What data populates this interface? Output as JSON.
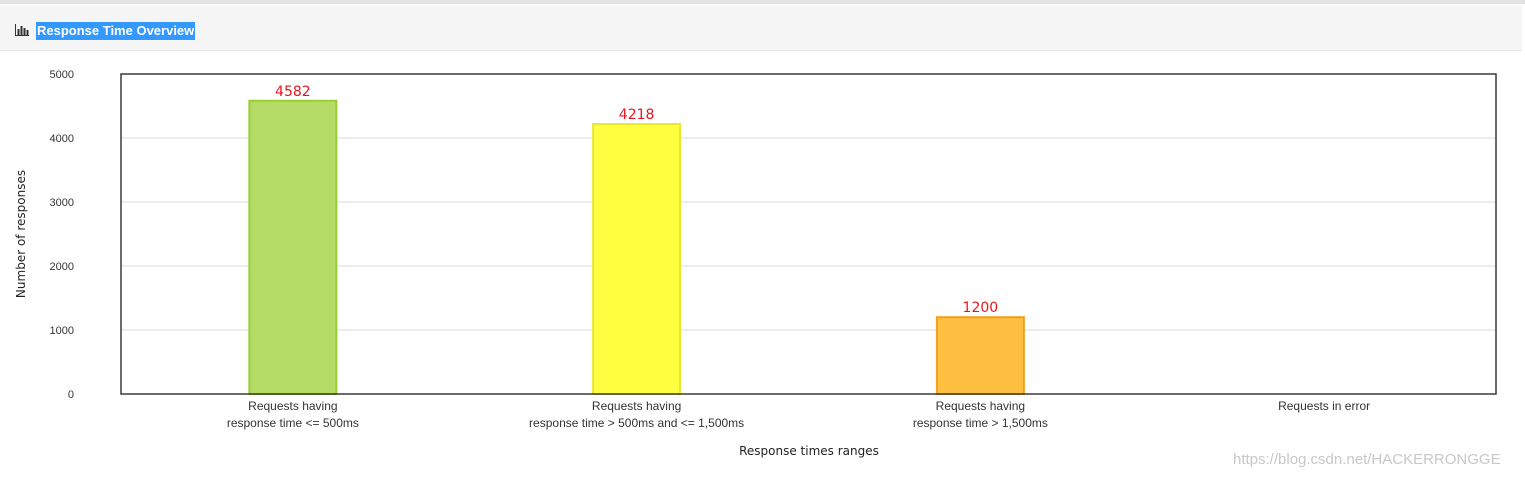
{
  "panel": {
    "title": "Response Time Overview",
    "icon": "bar-chart-icon"
  },
  "chart_data": {
    "type": "bar",
    "categories": [
      [
        "Requests having",
        "response time <= 500ms"
      ],
      [
        "Requests having",
        "response time > 500ms and <= 1,500ms"
      ],
      [
        "Requests having",
        "response time > 1,500ms"
      ],
      [
        "Requests in error"
      ]
    ],
    "values": [
      4582,
      4218,
      1200,
      0
    ],
    "data_labels": [
      "4582",
      "4218",
      "1200",
      ""
    ],
    "colors": [
      "#b5dc66",
      "#ffff40",
      "#ffbf40",
      "#ff6666"
    ],
    "border_colors": [
      "#9acd32",
      "#e6e633",
      "#f0a020",
      "#ff4040"
    ],
    "label_color": "#e8161b",
    "xlabel": "Response times ranges",
    "ylabel": "Number of responses",
    "ylim": [
      0,
      5000
    ],
    "yticks": [
      "0",
      "1000",
      "2000",
      "3000",
      "4000",
      "5000"
    ],
    "grid": true
  },
  "watermark": "https://blog.csdn.net/HACKERRONGGE"
}
